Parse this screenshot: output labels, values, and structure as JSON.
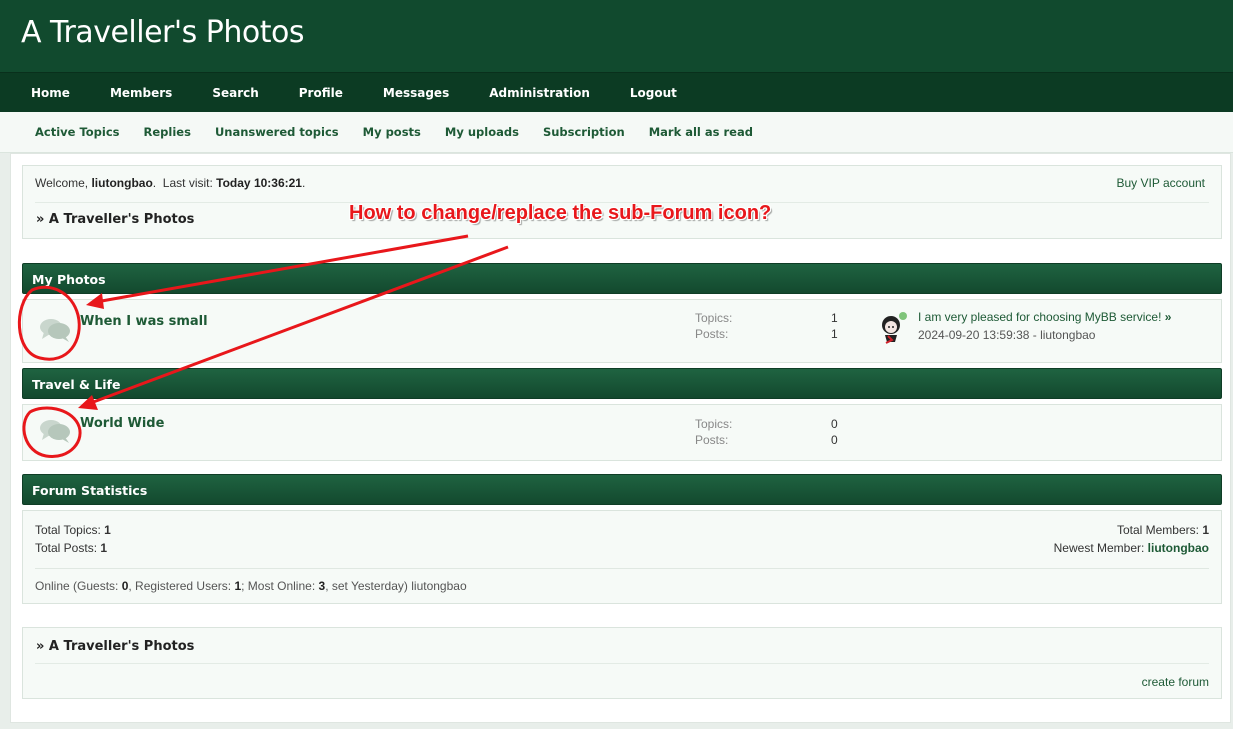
{
  "header": {
    "site_title": "A Traveller's Photos"
  },
  "main_nav": [
    {
      "label": "Home",
      "name": "nav-home"
    },
    {
      "label": "Members",
      "name": "nav-members"
    },
    {
      "label": "Search",
      "name": "nav-search"
    },
    {
      "label": "Profile",
      "name": "nav-profile"
    },
    {
      "label": "Messages",
      "name": "nav-messages"
    },
    {
      "label": "Administration",
      "name": "nav-administration"
    },
    {
      "label": "Logout",
      "name": "nav-logout"
    }
  ],
  "sub_nav": [
    {
      "label": "Active Topics",
      "name": "subnav-active-topics"
    },
    {
      "label": "Replies",
      "name": "subnav-replies"
    },
    {
      "label": "Unanswered topics",
      "name": "subnav-unanswered-topics"
    },
    {
      "label": "My posts",
      "name": "subnav-my-posts"
    },
    {
      "label": "My uploads",
      "name": "subnav-my-uploads"
    },
    {
      "label": "Subscription",
      "name": "subnav-subscription"
    },
    {
      "label": "Mark all as read",
      "name": "subnav-mark-all-read"
    }
  ],
  "welcome": {
    "prefix": "Welcome, ",
    "username": "liutongbao",
    "last_visit_label": ".  Last visit: ",
    "last_visit_value": "Today 10:36:21",
    "suffix": ".",
    "vip_link": "Buy VIP account",
    "breadcrumb": "» A Traveller's Photos"
  },
  "categories": [
    {
      "title": "My Photos",
      "forum": {
        "name": "When I was small",
        "topics_label": "Topics:",
        "topics": "1",
        "posts_label": "Posts:",
        "posts": "1",
        "last_post_title": "I am very pleased for choosing MyBB service!",
        "last_post_arrow": "»",
        "last_post_meta": "2024-09-20 13:59:38 - liutongbao"
      }
    },
    {
      "title": "Travel & Life",
      "forum": {
        "name": "World Wide",
        "topics_label": "Topics:",
        "topics": "0",
        "posts_label": "Posts:",
        "posts": "0"
      }
    }
  ],
  "statistics": {
    "title": "Forum Statistics",
    "total_topics_label": "Total Topics: ",
    "total_topics": "1",
    "total_posts_label": "Total Posts: ",
    "total_posts": "1",
    "total_members_label": "Total Members: ",
    "total_members": "1",
    "newest_member_label": "Newest Member: ",
    "newest_member": "liutongbao",
    "online_prefix": "Online (Guests: ",
    "guests": "0",
    "registered_label": ", Registered Users: ",
    "registered": "1",
    "most_online_label": "; Most Online: ",
    "most_online": "3",
    "online_suffix": ", set Yesterday) liutongbao"
  },
  "footer": {
    "breadcrumb": "» A Traveller's Photos",
    "create_forum": "create forum"
  },
  "annotation": {
    "text": "How to change/replace the sub-Forum icon?",
    "color": "#e8171b"
  },
  "colors": {
    "header_bg": "#114a2e",
    "nav_bg": "#0c3b23",
    "category_bar": "#1a5a3a",
    "link": "#1e5a36"
  }
}
